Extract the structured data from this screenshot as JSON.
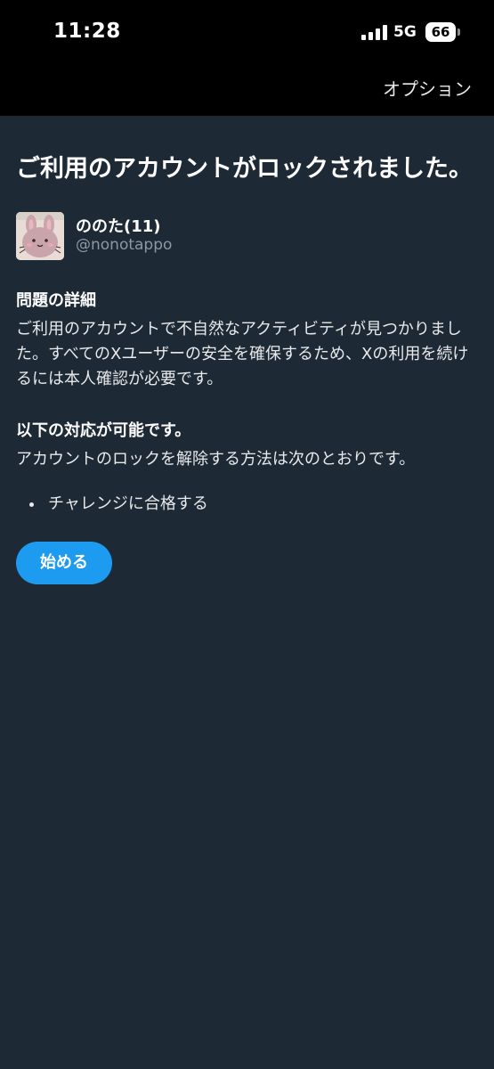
{
  "status_bar": {
    "time": "11:28",
    "network": "5G",
    "battery": "66"
  },
  "nav": {
    "options_label": "オプション"
  },
  "title": "ご利用のアカウントがロックされました。",
  "account": {
    "display_name": "ののた(11)",
    "handle": "@nonotappo"
  },
  "details": {
    "heading": "問題の詳細",
    "text": "ご利用のアカウントで不自然なアクティビティが見つかりました。すべてのXユーザーの安全を確保するため、Xの利用を続けるには本人確認が必要です。"
  },
  "options": {
    "heading": "以下の対応が可能です。",
    "text": "アカウントのロックを解除する方法は次のとおりです。",
    "items": [
      "チャレンジに合格する"
    ]
  },
  "start_button_label": "始める",
  "colors": {
    "background": "#1e2936",
    "accent": "#1d9bf0",
    "secondary_text": "#8b98a5"
  }
}
